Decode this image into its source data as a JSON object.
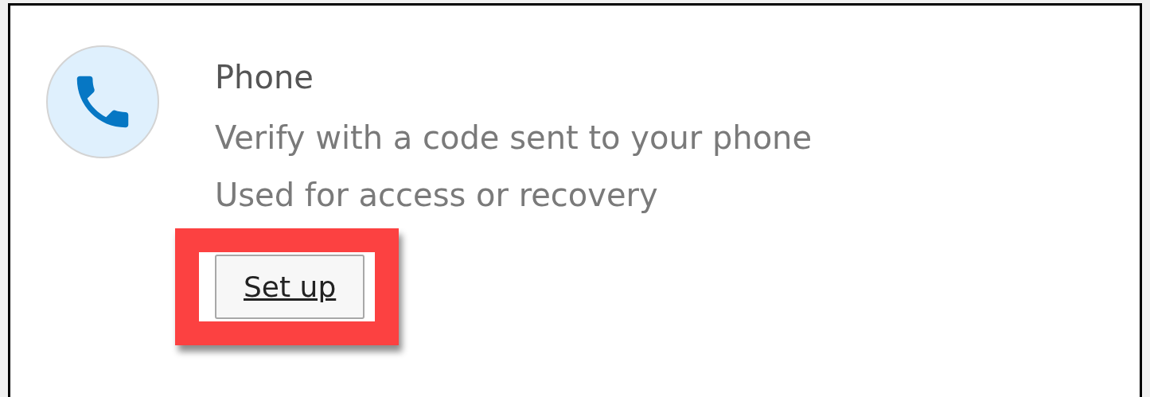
{
  "method": {
    "title": "Phone",
    "lines": [
      "Verify with a code sent to your phone",
      "Used for access or recovery"
    ],
    "button": {
      "label": "Set up",
      "highlighted": true
    }
  }
}
